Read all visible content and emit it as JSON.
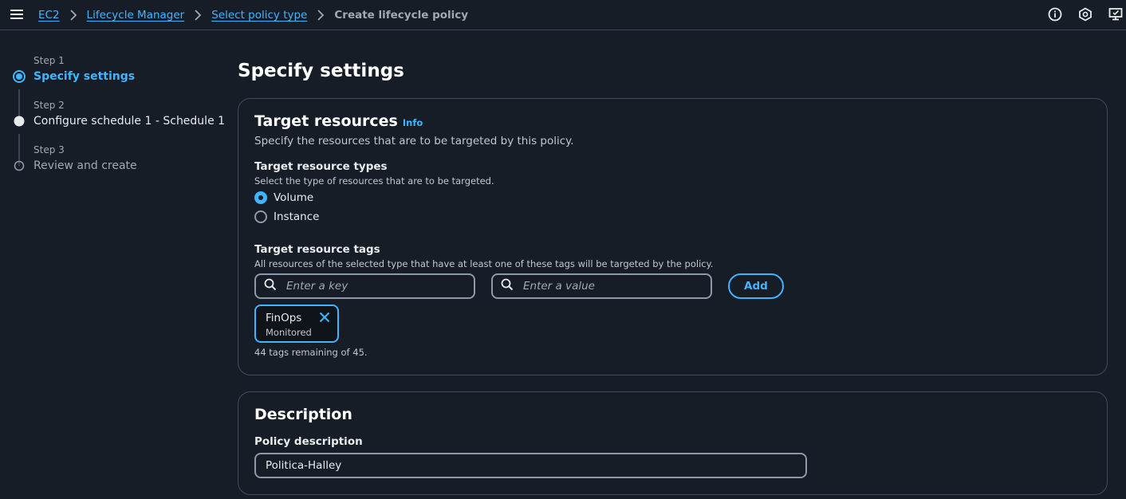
{
  "breadcrumb": {
    "items": [
      "EC2",
      "Lifecycle Manager",
      "Select policy type"
    ],
    "current": "Create lifecycle policy"
  },
  "top_icons": [
    "info-icon",
    "notifications-icon",
    "feedback-icon"
  ],
  "steps": [
    {
      "label": "Step 1",
      "title": "Specify settings",
      "state": "active"
    },
    {
      "label": "Step 2",
      "title": "Configure schedule 1 - Schedule 1",
      "state": "visited"
    },
    {
      "label": "Step 3",
      "title": "Review and create",
      "state": "pending"
    }
  ],
  "page": {
    "title": "Specify settings"
  },
  "target": {
    "title": "Target resources",
    "info": "Info",
    "description": "Specify the resources that are to be targeted by this policy.",
    "types_label": "Target resource types",
    "types_hint": "Select the type of resources that are to be targeted.",
    "types": [
      {
        "label": "Volume",
        "checked": true
      },
      {
        "label": "Instance",
        "checked": false
      }
    ],
    "tags_label": "Target resource tags",
    "tags_hint": "All resources of the selected type that have at least one of these tags will be targeted by the policy.",
    "key_placeholder": "Enter a key",
    "value_placeholder": "Enter a value",
    "add_label": "Add",
    "token": {
      "key": "FinOps",
      "value": "Monitored"
    },
    "remaining": "44 tags remaining of 45."
  },
  "description_section": {
    "title": "Description",
    "field_label": "Policy description",
    "value": "Politica-Halley"
  },
  "colors": {
    "background": "#161d26",
    "accent": "#42b4ff",
    "border": "#414d5c",
    "text": "#c6c6cd",
    "heading": "#ffffff"
  }
}
